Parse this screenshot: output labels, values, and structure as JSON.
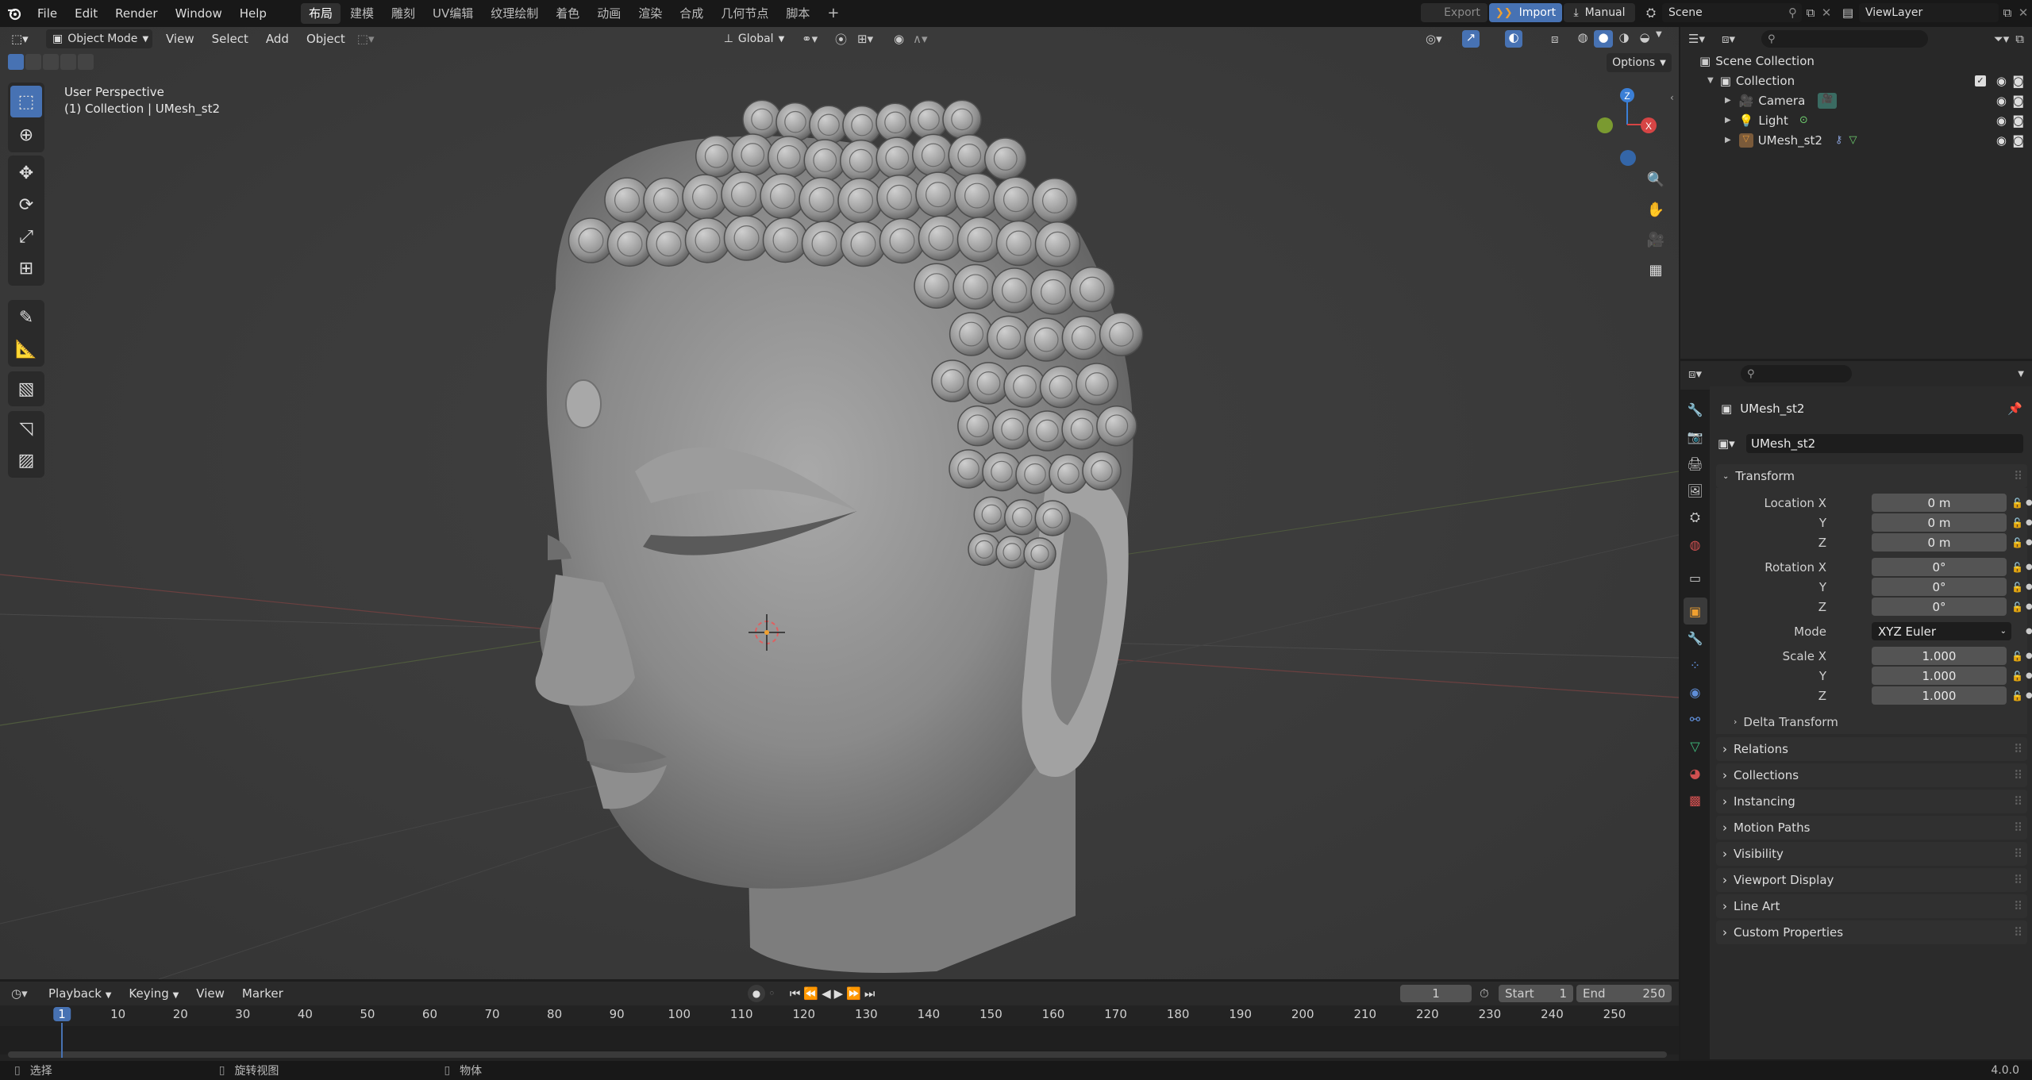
{
  "menu": {
    "items": [
      "File",
      "Edit",
      "Render",
      "Window",
      "Help"
    ]
  },
  "workspaces": {
    "tabs": [
      "布局",
      "建模",
      "雕刻",
      "UV编辑",
      "纹理绘制",
      "着色",
      "动画",
      "渲染",
      "合成",
      "几何节点",
      "脚本"
    ],
    "active": "布局",
    "add": "+"
  },
  "topright": {
    "export": "Export",
    "import": "Import",
    "manual": "Manual",
    "scene": "Scene",
    "viewlayer": "ViewLayer"
  },
  "viewport": {
    "mode": "Object Mode",
    "menus": [
      "View",
      "Select",
      "Add",
      "Object"
    ],
    "orientation": "Global",
    "options": "Options",
    "info_line1": "User Perspective",
    "info_line2": "(1) Collection | UMesh_st2",
    "gizmo": {
      "z": "Z",
      "x": "X"
    }
  },
  "outliner": {
    "scene_collection": "Scene Collection",
    "collection": "Collection",
    "items": [
      "Camera",
      "Light",
      "UMesh_st2"
    ]
  },
  "properties": {
    "object_name": "UMesh_st2",
    "datablock_name": "UMesh_st2",
    "transform": "Transform",
    "location": {
      "label_x": "Location X",
      "label_y": "Y",
      "label_z": "Z",
      "x": "0 m",
      "y": "0 m",
      "z": "0 m"
    },
    "rotation": {
      "label_x": "Rotation X",
      "label_y": "Y",
      "label_z": "Z",
      "x": "0°",
      "y": "0°",
      "z": "0°"
    },
    "mode_label": "Mode",
    "mode_value": "XYZ Euler",
    "scale": {
      "label_x": "Scale X",
      "label_y": "Y",
      "label_z": "Z",
      "x": "1.000",
      "y": "1.000",
      "z": "1.000"
    },
    "delta": "Delta Transform",
    "panels": [
      "Relations",
      "Collections",
      "Instancing",
      "Motion Paths",
      "Visibility",
      "Viewport Display",
      "Line Art",
      "Custom Properties"
    ]
  },
  "timeline": {
    "menus": [
      "Playback",
      "Keying",
      "View",
      "Marker"
    ],
    "current_frame": "1",
    "start_label": "Start",
    "start": "1",
    "end_label": "End",
    "end": "250",
    "ticks": [
      "1",
      "10",
      "20",
      "30",
      "40",
      "50",
      "60",
      "70",
      "80",
      "90",
      "100",
      "110",
      "120",
      "130",
      "140",
      "150",
      "160",
      "170",
      "180",
      "190",
      "200",
      "210",
      "220",
      "230",
      "240",
      "250"
    ]
  },
  "status": {
    "select": "选择",
    "rotate": "旋转视图",
    "object": "物体",
    "version": "4.0.0"
  }
}
